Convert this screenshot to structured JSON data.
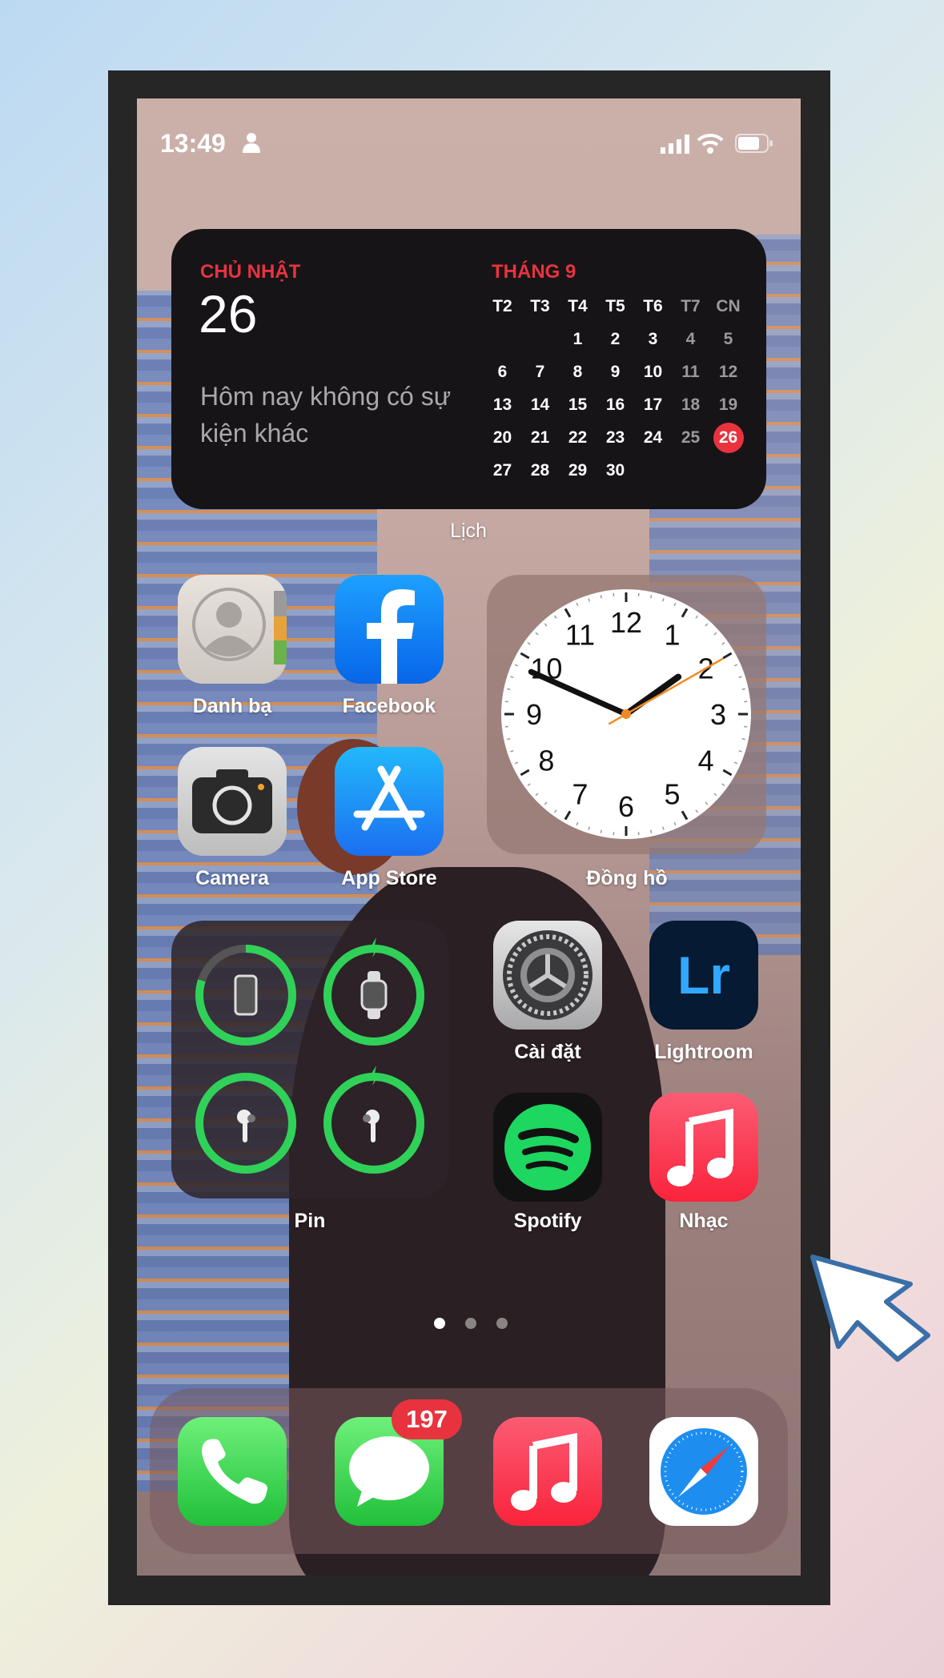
{
  "status_bar": {
    "time": "13:49",
    "person_icon": "person-icon",
    "signal_icon": "cellular-signal-icon",
    "wifi_icon": "wifi-icon",
    "battery_icon": "battery-icon"
  },
  "calendar_widget": {
    "weekday": "CHỦ NHẬT",
    "day": "26",
    "no_events": "Hôm nay không có sự kiện khác",
    "month": "THÁNG 9",
    "weekday_headers": [
      "T2",
      "T3",
      "T4",
      "T5",
      "T6",
      "T7",
      "CN"
    ],
    "weeks": [
      [
        "",
        "",
        "1",
        "2",
        "3",
        "4",
        "5"
      ],
      [
        "6",
        "7",
        "8",
        "9",
        "10",
        "11",
        "12"
      ],
      [
        "13",
        "14",
        "15",
        "16",
        "17",
        "18",
        "19"
      ],
      [
        "20",
        "21",
        "22",
        "23",
        "24",
        "25",
        "26"
      ],
      [
        "27",
        "28",
        "29",
        "30",
        "",
        "",
        ""
      ]
    ],
    "today": "26",
    "label": "Lịch",
    "accent_color": "#e8333f"
  },
  "apps": [
    {
      "label": "Danh bạ"
    },
    {
      "label": "Facebook"
    },
    {
      "label": "Camera"
    },
    {
      "label": "App Store"
    },
    {
      "label": "Cài đặt"
    },
    {
      "label": "Lightroom"
    },
    {
      "label": "Spotify"
    },
    {
      "label": "Nhạc"
    }
  ],
  "clock_widget": {
    "label": "Đồng hồ",
    "time": "13:49",
    "numbers": [
      "12",
      "1",
      "2",
      "3",
      "4",
      "5",
      "6",
      "7",
      "8",
      "9",
      "10",
      "11"
    ]
  },
  "battery_widget": {
    "label": "Pin",
    "devices": [
      {
        "name": "iPhone",
        "level": 0.8,
        "charging": false
      },
      {
        "name": "Apple Watch",
        "level": 1.0,
        "charging": true
      },
      {
        "name": "AirPods left",
        "level": 1.0,
        "charging": false
      },
      {
        "name": "AirPods right",
        "level": 1.0,
        "charging": true
      }
    ],
    "ring_color": "#30d158"
  },
  "page_dots": {
    "count": 3,
    "current": 1
  },
  "dock": {
    "apps": [
      "Phone",
      "Messages",
      "Music",
      "Safari"
    ],
    "messages_badge": "197"
  },
  "lightroom_text": "Lr"
}
